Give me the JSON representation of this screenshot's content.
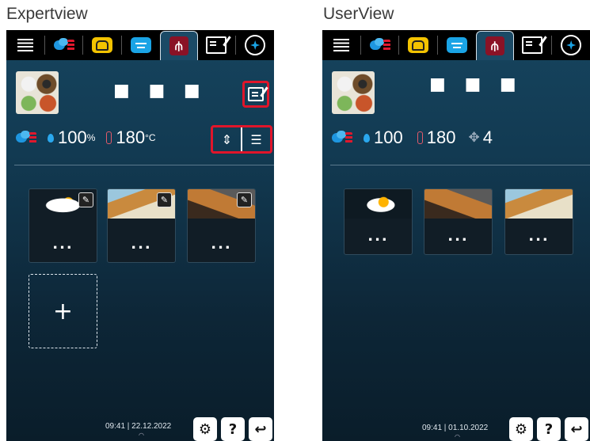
{
  "captions": {
    "left": "Expertview",
    "right": "UserView"
  },
  "tabs": [
    "menu-icon",
    "steam-heat-icon",
    "chef-hat-icon",
    "program-list-icon",
    "cooking-path-icon",
    "edit-icon",
    "smart-icon"
  ],
  "expert": {
    "title": "■ ■ ■",
    "humidity": "100",
    "humidity_unit": "%",
    "temperature": "180",
    "temperature_unit": "°C",
    "cards": [
      {
        "label": "..."
      },
      {
        "label": "..."
      },
      {
        "label": "..."
      }
    ],
    "add_label": "+",
    "clock": "09:41 | 22.12.2022"
  },
  "user": {
    "title": "■ ■ ■",
    "humidity": "100",
    "temperature": "180",
    "fan": "4",
    "cards": [
      {
        "label": "..."
      },
      {
        "label": "..."
      },
      {
        "label": "..."
      }
    ],
    "clock": "09:41 | 01.10.2022"
  },
  "bottom_buttons": {
    "help": "?",
    "back": "↩"
  },
  "colors": {
    "accent_red": "#e0152a",
    "tab_red": "#8a1226",
    "blue": "#1aa4e6",
    "yellow": "#f3c300"
  }
}
